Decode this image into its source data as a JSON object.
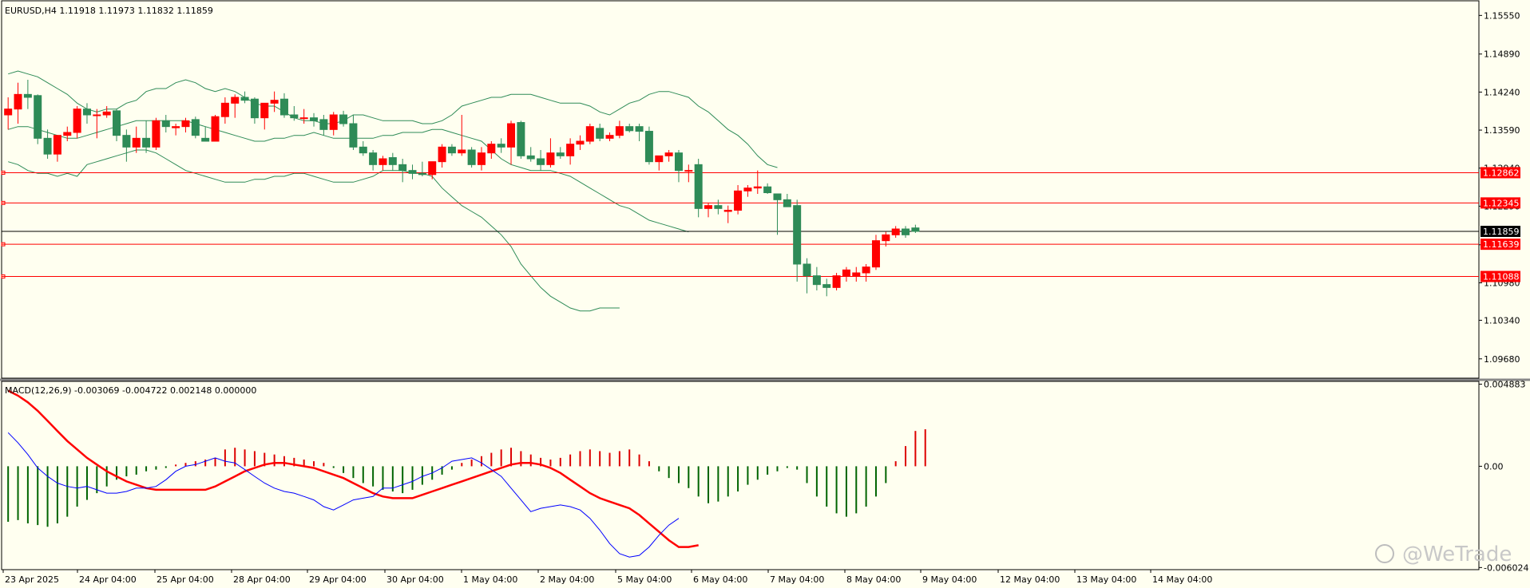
{
  "window": {
    "header_label": "EURUSD,H4  1.11918 1.11973 1.11832 1.11859",
    "watermark": "@WeTrade"
  },
  "colors": {
    "background": "#fffff0",
    "bull_candle": "#ff0000",
    "bear_candle": "#2e8b57",
    "bands": "#2e8b57",
    "level_lines": "#ff0000",
    "current_price_line": "#000000",
    "macd_hist_pos": "#dd0000",
    "macd_hist_neg": "#006400",
    "macd_signal": "#ff0000",
    "macd_line": "#0000ff"
  },
  "price_chart": {
    "symbol": "EURUSD",
    "timeframe": "H4",
    "ohlc_header": [
      "1.11918",
      "1.11973",
      "1.11832",
      "1.11859"
    ],
    "ylim": [
      1.0935,
      1.158
    ],
    "y_ticks": [
      "1.15550",
      "1.14890",
      "1.14240",
      "1.13590",
      "1.12940",
      "1.12290",
      "1.11630",
      "1.10980",
      "1.10340",
      "1.09680"
    ],
    "current_price": "1.11859",
    "levels": [
      "1.12862",
      "1.12345",
      "1.11639",
      "1.11088"
    ]
  },
  "chart_data": {
    "type": "candlestick",
    "x_labels": [
      "23 Apr 2025",
      "24 Apr 04:00",
      "25 Apr 04:00",
      "28 Apr 04:00",
      "29 Apr 04:00",
      "30 Apr 04:00",
      "1 May 04:00",
      "2 May 04:00",
      "5 May 04:00",
      "6 May 04:00",
      "7 May 04:00",
      "8 May 04:00",
      "9 May 04:00",
      "12 May 04:00",
      "13 May 04:00",
      "14 May 04:00"
    ],
    "candles": [
      [
        1.1385,
        1.1415,
        1.136,
        1.1395
      ],
      [
        1.1395,
        1.144,
        1.137,
        1.142
      ],
      [
        1.142,
        1.1445,
        1.1395,
        1.1415
      ],
      [
        1.1418,
        1.142,
        1.1335,
        1.1345
      ],
      [
        1.1345,
        1.136,
        1.131,
        1.1318
      ],
      [
        1.1318,
        1.135,
        1.1305,
        1.135
      ],
      [
        1.135,
        1.1365,
        1.134,
        1.1355
      ],
      [
        1.1355,
        1.14,
        1.1345,
        1.1395
      ],
      [
        1.1395,
        1.1405,
        1.137,
        1.1385
      ],
      [
        1.1385,
        1.1395,
        1.1345,
        1.1385
      ],
      [
        1.1385,
        1.14,
        1.138,
        1.139
      ],
      [
        1.1392,
        1.1395,
        1.134,
        1.135
      ],
      [
        1.135,
        1.136,
        1.1305,
        1.133
      ],
      [
        1.133,
        1.1365,
        1.132,
        1.1345
      ],
      [
        1.1345,
        1.1375,
        1.132,
        1.133
      ],
      [
        1.133,
        1.138,
        1.1325,
        1.1375
      ],
      [
        1.1375,
        1.1385,
        1.1355,
        1.1365
      ],
      [
        1.1363,
        1.137,
        1.135,
        1.1365
      ],
      [
        1.1365,
        1.138,
        1.1355,
        1.1375
      ],
      [
        1.1377,
        1.1382,
        1.1345,
        1.135
      ],
      [
        1.1345,
        1.1365,
        1.134,
        1.134
      ],
      [
        1.134,
        1.1385,
        1.1345,
        1.1382
      ],
      [
        1.1382,
        1.1415,
        1.137,
        1.1405
      ],
      [
        1.1405,
        1.142,
        1.138,
        1.1415
      ],
      [
        1.1415,
        1.1425,
        1.1405,
        1.141
      ],
      [
        1.1412,
        1.1415,
        1.137,
        1.138
      ],
      [
        1.138,
        1.14,
        1.136,
        1.1405
      ],
      [
        1.1405,
        1.1425,
        1.139,
        1.141
      ],
      [
        1.1412,
        1.1422,
        1.138,
        1.1385
      ],
      [
        1.1385,
        1.14,
        1.1375,
        1.138
      ],
      [
        1.138,
        1.1395,
        1.137,
        1.138
      ],
      [
        1.138,
        1.1388,
        1.1365,
        1.1375
      ],
      [
        1.1377,
        1.1385,
        1.135,
        1.136
      ],
      [
        1.136,
        1.139,
        1.135,
        1.1385
      ],
      [
        1.1385,
        1.1392,
        1.1365,
        1.137
      ],
      [
        1.137,
        1.1385,
        1.1325,
        1.133
      ],
      [
        1.133,
        1.134,
        1.1315,
        1.132
      ],
      [
        1.132,
        1.1325,
        1.129,
        1.13
      ],
      [
        1.13,
        1.1315,
        1.129,
        1.131
      ],
      [
        1.1312,
        1.132,
        1.129,
        1.13
      ],
      [
        1.13,
        1.131,
        1.127,
        1.129
      ],
      [
        1.129,
        1.13,
        1.1275,
        1.1285
      ],
      [
        1.1285,
        1.1305,
        1.128,
        1.1283
      ],
      [
        1.1283,
        1.13,
        1.1275,
        1.1305
      ],
      [
        1.1305,
        1.1335,
        1.1295,
        1.133
      ],
      [
        1.133,
        1.1335,
        1.1315,
        1.132
      ],
      [
        1.132,
        1.1385,
        1.1315,
        1.1325
      ],
      [
        1.1325,
        1.133,
        1.1295,
        1.13
      ],
      [
        1.13,
        1.133,
        1.129,
        1.132
      ],
      [
        1.132,
        1.134,
        1.131,
        1.1335
      ],
      [
        1.1335,
        1.1345,
        1.132,
        1.133
      ],
      [
        1.133,
        1.1375,
        1.13,
        1.137
      ],
      [
        1.1372,
        1.1375,
        1.131,
        1.1315
      ],
      [
        1.1315,
        1.133,
        1.1305,
        1.131
      ],
      [
        1.131,
        1.1325,
        1.129,
        1.13
      ],
      [
        1.13,
        1.1345,
        1.1295,
        1.132
      ],
      [
        1.132,
        1.133,
        1.131,
        1.1315
      ],
      [
        1.1315,
        1.1345,
        1.13,
        1.1335
      ],
      [
        1.1335,
        1.135,
        1.1325,
        1.134
      ],
      [
        1.134,
        1.137,
        1.1335,
        1.1365
      ],
      [
        1.1362,
        1.137,
        1.134,
        1.1345
      ],
      [
        1.1345,
        1.1355,
        1.134,
        1.135
      ],
      [
        1.135,
        1.1375,
        1.1345,
        1.1365
      ],
      [
        1.1365,
        1.137,
        1.1355,
        1.1358
      ],
      [
        1.1365,
        1.137,
        1.134,
        1.1357
      ],
      [
        1.1357,
        1.1365,
        1.13,
        1.1305
      ],
      [
        1.1305,
        1.1315,
        1.129,
        1.1315
      ],
      [
        1.1315,
        1.1325,
        1.1305,
        1.132
      ],
      [
        1.132,
        1.1325,
        1.127,
        1.129
      ],
      [
        1.129,
        1.13,
        1.127,
        1.129
      ],
      [
        1.13,
        1.131,
        1.121,
        1.1225
      ],
      [
        1.1225,
        1.1235,
        1.121,
        1.123
      ],
      [
        1.123,
        1.124,
        1.1215,
        1.1225
      ],
      [
        1.122,
        1.123,
        1.12,
        1.1222
      ],
      [
        1.1222,
        1.1265,
        1.1215,
        1.1255
      ],
      [
        1.1255,
        1.1265,
        1.1245,
        1.126
      ],
      [
        1.126,
        1.129,
        1.125,
        1.1262
      ],
      [
        1.1262,
        1.1268,
        1.125,
        1.1252
      ],
      [
        1.125,
        1.125,
        1.118,
        1.124
      ],
      [
        1.124,
        1.125,
        1.123,
        1.1228
      ],
      [
        1.123,
        1.124,
        1.11,
        1.113
      ],
      [
        1.113,
        1.114,
        1.108,
        1.111
      ],
      [
        1.111,
        1.1125,
        1.1085,
        1.1095
      ],
      [
        1.1095,
        1.1105,
        1.1075,
        1.109
      ],
      [
        1.109,
        1.1115,
        1.1085,
        1.111
      ],
      [
        1.111,
        1.1125,
        1.11,
        1.112
      ],
      [
        1.111,
        1.1125,
        1.11,
        1.1115
      ],
      [
        1.1115,
        1.113,
        1.11,
        1.1125
      ],
      [
        1.1125,
        1.118,
        1.112,
        1.117
      ],
      [
        1.117,
        1.1185,
        1.116,
        1.118
      ],
      [
        1.118,
        1.1195,
        1.1175,
        1.119
      ],
      [
        1.119,
        1.1195,
        1.1175,
        1.118
      ],
      [
        1.11918,
        1.11973,
        1.11832,
        1.11859
      ]
    ],
    "bands": {
      "upper": [
        1.1455,
        1.146,
        1.1455,
        1.145,
        1.144,
        1.143,
        1.142,
        1.1405,
        1.1395,
        1.139,
        1.1395,
        1.1395,
        1.1405,
        1.141,
        1.1425,
        1.143,
        1.143,
        1.144,
        1.1445,
        1.144,
        1.143,
        1.1425,
        1.143,
        1.1425,
        1.1415,
        1.1405,
        1.14,
        1.14,
        1.139,
        1.138,
        1.1375,
        1.1375,
        1.137,
        1.137,
        1.1375,
        1.1385,
        1.1385,
        1.138,
        1.1375,
        1.1375,
        1.1375,
        1.1375,
        1.137,
        1.137,
        1.1375,
        1.1385,
        1.14,
        1.1405,
        1.141,
        1.1415,
        1.1415,
        1.142,
        1.142,
        1.142,
        1.1415,
        1.141,
        1.1405,
        1.1405,
        1.1405,
        1.14,
        1.139,
        1.1385,
        1.1395,
        1.1405,
        1.141,
        1.142,
        1.1425,
        1.1425,
        1.142,
        1.1415,
        1.14,
        1.139,
        1.1375,
        1.136,
        1.135,
        1.1335,
        1.1315,
        1.13,
        1.1295
      ],
      "middle": [
        1.136,
        1.1365,
        1.1365,
        1.136,
        1.1355,
        1.135,
        1.1345,
        1.1345,
        1.135,
        1.1355,
        1.136,
        1.1365,
        1.137,
        1.1375,
        1.1375,
        1.1375,
        1.1375,
        1.1375,
        1.1375,
        1.137,
        1.1365,
        1.136,
        1.1355,
        1.135,
        1.1345,
        1.134,
        1.134,
        1.1345,
        1.1345,
        1.135,
        1.135,
        1.1355,
        1.135,
        1.1345,
        1.1345,
        1.1345,
        1.1345,
        1.1345,
        1.135,
        1.135,
        1.1355,
        1.1355,
        1.1355,
        1.136,
        1.136,
        1.1355,
        1.135,
        1.1345,
        1.134,
        1.1325,
        1.131,
        1.13,
        1.1295,
        1.129,
        1.129,
        1.129,
        1.1285,
        1.128,
        1.127,
        1.126,
        1.125,
        1.124,
        1.123,
        1.1225,
        1.1215,
        1.1205,
        1.12,
        1.1195,
        1.119,
        1.1185
      ],
      "lower": [
        1.1305,
        1.13,
        1.129,
        1.1285,
        1.1285,
        1.128,
        1.1285,
        1.128,
        1.13,
        1.1305,
        1.131,
        1.1315,
        1.132,
        1.1325,
        1.1325,
        1.132,
        1.131,
        1.13,
        1.129,
        1.1285,
        1.128,
        1.1275,
        1.127,
        1.127,
        1.127,
        1.1275,
        1.1275,
        1.128,
        1.128,
        1.1285,
        1.1285,
        1.128,
        1.1275,
        1.127,
        1.127,
        1.127,
        1.1275,
        1.128,
        1.129,
        1.129,
        1.129,
        1.1285,
        1.1285,
        1.128,
        1.126,
        1.1245,
        1.123,
        1.122,
        1.121,
        1.1195,
        1.118,
        1.116,
        1.113,
        1.111,
        1.109,
        1.1075,
        1.1065,
        1.1055,
        1.105,
        1.105,
        1.1055,
        1.1055,
        1.1055
      ]
    },
    "macd": {
      "label": "MACD(12,26,9) -0.003069 -0.004722 0.002148 0.000000",
      "y_ticks": [
        "0.004883",
        "0.00",
        "-0.006024"
      ],
      "ylim": [
        -0.00615,
        0.00505
      ],
      "histogram": [
        -0.0033,
        -0.0032,
        -0.0034,
        -0.0035,
        -0.0036,
        -0.0034,
        -0.003,
        -0.0024,
        -0.002,
        -0.0016,
        -0.0012,
        -0.0008,
        -0.0006,
        -0.0005,
        -0.0003,
        -0.0002,
        -0.0001,
        0.0001,
        0.0002,
        0.0003,
        0.0004,
        0.0005,
        0.001,
        0.0011,
        0.001,
        0.0009,
        0.0008,
        0.0007,
        0.0006,
        0.0005,
        0.0004,
        0.0003,
        0.0002,
        -0.0001,
        -0.0004,
        -0.0007,
        -0.001,
        -0.0012,
        -0.0014,
        -0.0015,
        -0.0016,
        -0.0014,
        -0.0011,
        -0.0008,
        -0.0005,
        -0.0002,
        0.0002,
        0.0004,
        0.0006,
        0.0008,
        0.001,
        0.0011,
        0.0009,
        0.0007,
        0.0005,
        0.0004,
        0.0005,
        0.0007,
        0.0009,
        0.001,
        0.0009,
        0.0008,
        0.0009,
        0.001,
        0.0007,
        0.0003,
        -0.0003,
        -0.0007,
        -0.001,
        -0.0013,
        -0.0018,
        -0.0022,
        -0.0021,
        -0.0018,
        -0.0015,
        -0.0011,
        -0.0008,
        -0.0005,
        -0.0003,
        -0.0001,
        -0.0002,
        -0.001,
        -0.0018,
        -0.0024,
        -0.0028,
        -0.003,
        -0.0028,
        -0.0024,
        -0.0018,
        -0.001,
        0.0003,
        0.0012,
        0.0021,
        0.0022
      ],
      "signal": [
        0.0045,
        0.0042,
        0.0038,
        0.0033,
        0.0027,
        0.0021,
        0.0015,
        0.001,
        0.0005,
        0.0001,
        -0.0003,
        -0.0006,
        -0.0009,
        -0.0011,
        -0.0013,
        -0.0014,
        -0.0014,
        -0.0014,
        -0.0014,
        -0.0014,
        -0.0014,
        -0.0012,
        -0.0009,
        -0.0006,
        -0.0003,
        -0.0001,
        0.0001,
        0.0002,
        0.0002,
        0.0001,
        0.0,
        -0.0001,
        -0.0003,
        -0.0005,
        -0.0007,
        -0.001,
        -0.0013,
        -0.0016,
        -0.0018,
        -0.0019,
        -0.0019,
        -0.0019,
        -0.0017,
        -0.0015,
        -0.0013,
        -0.0011,
        -0.0009,
        -0.0007,
        -0.0005,
        -0.0003,
        -0.0001,
        0.0001,
        0.0002,
        0.0002,
        0.0001,
        -0.0001,
        -0.0004,
        -0.0008,
        -0.0012,
        -0.0016,
        -0.0019,
        -0.0021,
        -0.0023,
        -0.0025,
        -0.0029,
        -0.0034,
        -0.0039,
        -0.0044,
        -0.0048,
        -0.0048,
        -0.0047
      ],
      "main": [
        0.002,
        0.0014,
        0.0007,
        -0.0001,
        -0.0006,
        -0.001,
        -0.0012,
        -0.0013,
        -0.0012,
        -0.0014,
        -0.0016,
        -0.0016,
        -0.0015,
        -0.0013,
        -0.0013,
        -0.0012,
        -0.0008,
        -0.0003,
        0.0,
        0.0001,
        0.0003,
        0.0005,
        0.0003,
        0.0002,
        -0.0002,
        -0.0006,
        -0.001,
        -0.0013,
        -0.0015,
        -0.0016,
        -0.0018,
        -0.002,
        -0.0024,
        -0.0026,
        -0.0023,
        -0.002,
        -0.0019,
        -0.0018,
        -0.0013,
        -0.0013,
        -0.0011,
        -0.0009,
        -0.0006,
        -0.0004,
        -0.0001,
        0.0003,
        0.0004,
        0.0005,
        0.0002,
        -0.0002,
        -0.0006,
        -0.0013,
        -0.002,
        -0.0027,
        -0.0025,
        -0.0024,
        -0.0023,
        -0.0024,
        -0.0026,
        -0.0031,
        -0.0038,
        -0.0046,
        -0.0052,
        -0.0054,
        -0.0053,
        -0.0048,
        -0.0041,
        -0.0035,
        -0.0031
      ]
    }
  }
}
